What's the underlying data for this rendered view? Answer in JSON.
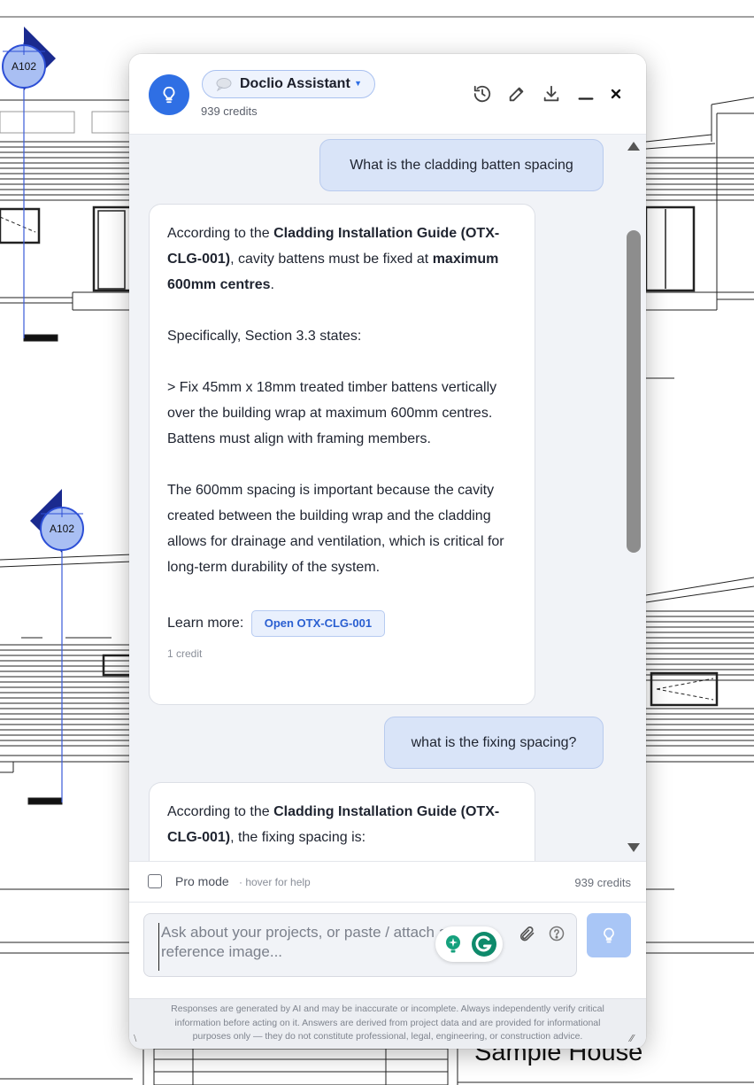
{
  "drawing": {
    "section_marker_1": "A102",
    "section_marker_2": "A102",
    "title_block_text": "Sample House"
  },
  "header": {
    "assistant_name": "Doclio Assistant",
    "credits": "939 credits",
    "icons": [
      "history-icon",
      "edit-icon",
      "download-icon",
      "minimize-icon",
      "close-icon"
    ]
  },
  "messages": [
    {
      "role": "user",
      "text": "What is the cladding batten spacing"
    },
    {
      "role": "assistant",
      "p1_a": "According to the ",
      "p1_b": "Cladding Installation Guide (OTX-CLG-001)",
      "p1_c": ", cavity battens must be fixed at ",
      "p1_d": "maximum 600mm centres",
      "p1_e": ".",
      "p2": "Specifically, Section 3.3 states:",
      "p3": "> Fix 45mm x 18mm treated timber battens vertically over the building wrap at maximum 600mm centres. Battens must align with framing members.",
      "p4": "The 600mm spacing is important because the cavity created between the building wrap and the cladding allows for drainage and ventilation, which is critical for long-term durability of the system.",
      "learn_more": "Learn more:",
      "open_button": "Open OTX-CLG-001",
      "credit": "1 credit"
    },
    {
      "role": "user",
      "text": "what is the fixing spacing?"
    },
    {
      "role": "assistant",
      "p1_a": "According to the ",
      "p1_b": "Cladding Installation Guide (OTX-CLG-001)",
      "p1_c": ", the fixing spacing is:"
    }
  ],
  "pro_mode": {
    "label": "Pro mode",
    "hint": "· hover for help",
    "credits": "939 credits",
    "checked": false
  },
  "composer": {
    "placeholder": "Ask about your projects, or paste / attach a reference image..."
  },
  "disclaimer": "Responses are generated by AI and may be inaccurate or incomplete. Always independently verify critical information before acting on it. Answers are derived from project data and are provided for informational purposes only — they do not constitute professional, legal, engineering, or construction advice.",
  "colors": {
    "accent": "#2f6fe4",
    "user_bubble": "#d9e4f8",
    "send_button": "#a9c6f6",
    "scroll_thumb": "#8d8d8d"
  }
}
